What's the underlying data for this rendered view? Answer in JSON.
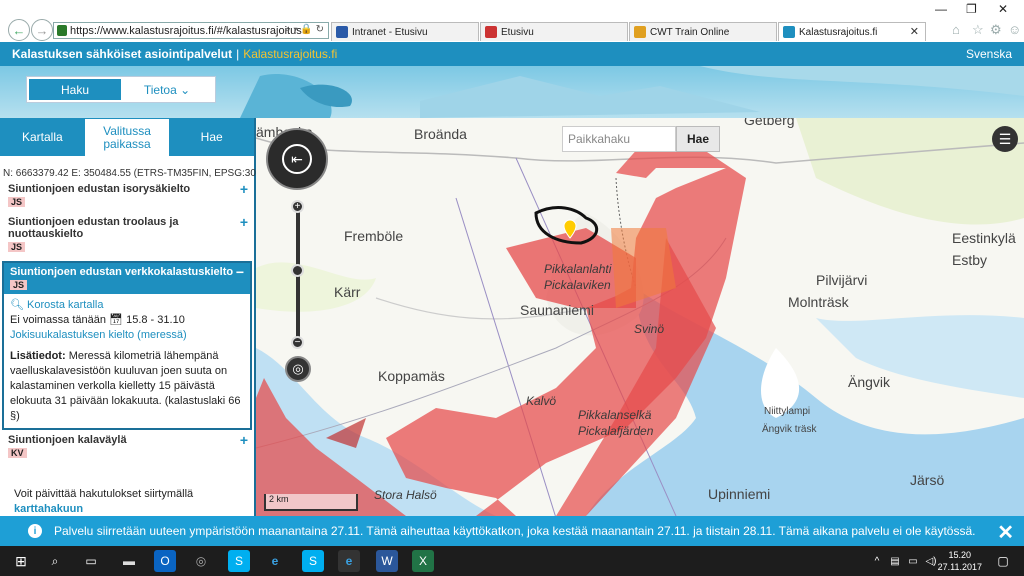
{
  "browser": {
    "url": "https://www.kalastusrajoitus.fi/#/kalastusrajoitus",
    "tabs": [
      {
        "label": "Intranet - Etusivu",
        "color": "#2a5aa8"
      },
      {
        "label": "Etusivu",
        "color": "#cc3333"
      },
      {
        "label": "CWT Train Online",
        "color": "#e0a020"
      },
      {
        "label": "Kalastusrajoitus.fi",
        "color": "#1e8fbf"
      }
    ]
  },
  "header": {
    "title": "Kalastuksen sähköiset asiointipalvelut",
    "separator": "|",
    "site": "Kalastusrajoitus.fi",
    "lang": "Svenska"
  },
  "topnav": {
    "search": "Haku",
    "info": "Tietoa ⌄"
  },
  "sidebar": {
    "tabs": [
      "Kartalla",
      "Valitussa paikassa",
      "Hae"
    ],
    "coords": "N: 6663379.42  E: 350484.55  (ETRS-TM35FIN, EPSG:3067)",
    "items": [
      {
        "title": "Siuntionjoen edustan isorysäkielto",
        "badge": "JS"
      },
      {
        "title": "Siuntionjoen edustan troolaus ja nuottauskielto",
        "badge": "JS"
      }
    ],
    "open": {
      "title": "Siuntionjoen edustan verkkokalastuskielto",
      "badge": "JS",
      "highlight": "Korosta kartalla",
      "status": "Ei voimassa tänään",
      "dates": "15.8 - 31.10",
      "rule": "Jokisuukalastuksen kielto (meressä)",
      "info_label": "Lisätiedot:",
      "info_text": "Meressä kilometriä lähempänä vaelluskalavesistöön kuuluvan joen suuta on kalastaminen verkolla kielletty 15 päivästä elokuuta 31 päivään lokakuuta. (kalastuslaki 66 §)"
    },
    "last": {
      "title": "Siuntionjoen kalaväylä",
      "badge": "KV"
    },
    "footer_text": "Voit päivittää hakutulokset siirtymällä",
    "footer_link": "karttahakuun"
  },
  "map": {
    "search_placeholder": "Paikkahaku",
    "search_button": "Hae",
    "scale": "2 km",
    "labels": [
      "Broända",
      "Getberg",
      "Fremböle",
      "Eestinkylä",
      "Estby",
      "Pilvijärvi",
      "Molnträsk",
      "Kärr",
      "Sauna­niemi",
      "Koppamäs",
      "Ängvik",
      "Niittylampi",
      "Ängvik träsk",
      "Järsö",
      "Upinniemi",
      "Stora Halsö",
      "ämbacka"
    ],
    "water_labels": [
      "Pikkalanlahti",
      "Pickalaviken",
      "Svinö",
      "Kalvö",
      "Pikkalanselkä",
      "Pickalafjärden"
    ]
  },
  "notice": {
    "text": "Palvelu siirretään uuteen ympäristöön maanantaina 27.11. Tämä aiheuttaa käyttökatkon, joka kestää maanantain 27.11. ja tiistain 28.11. Tämä aikana palvelu ei ole käytössä."
  },
  "taskbar": {
    "time": "15.20",
    "date": "27.11.2017"
  }
}
